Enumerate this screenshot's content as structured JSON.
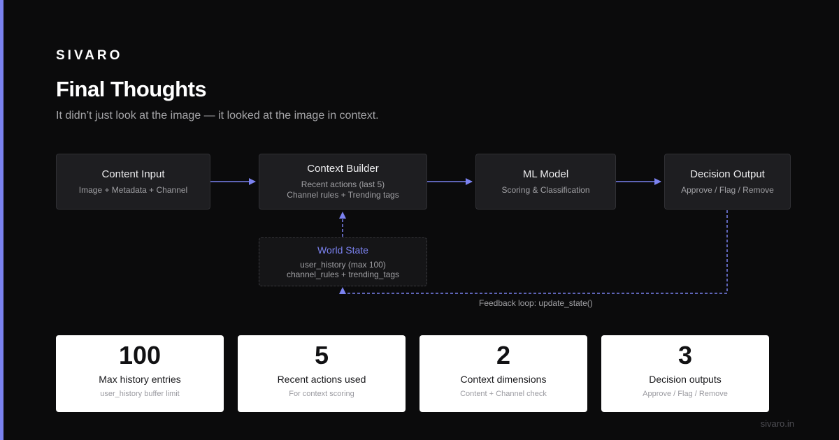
{
  "brand": "SIVARO",
  "title": "Final Thoughts",
  "subtitle": "It didn’t just look at the image — it looked at the image in context.",
  "colors": {
    "background": "#0b0b0c",
    "accent": "#7b82f0",
    "node": "#1e1e21",
    "card": "#ffffff"
  },
  "nodes": {
    "content_input": {
      "name": "Content Input",
      "desc": "Image + Metadata + Channel"
    },
    "context_builder": {
      "name": "Context Builder",
      "desc_1": "Recent actions (last 5)",
      "desc_2": "Channel rules + Trending tags"
    },
    "ml_model": {
      "name": "ML Model",
      "desc": "Scoring & Classification"
    },
    "decision_output": {
      "name": "Decision Output",
      "desc": "Approve / Flag / Remove"
    },
    "world_state": {
      "name": "World State",
      "desc_1": "user_history (max 100)",
      "desc_2": "channel_rules + trending_tags"
    }
  },
  "edges": [
    {
      "from": "content_input",
      "to": "context_builder",
      "style": "solid"
    },
    {
      "from": "context_builder",
      "to": "ml_model",
      "style": "solid"
    },
    {
      "from": "ml_model",
      "to": "decision_output",
      "style": "solid"
    },
    {
      "from": "world_state",
      "to": "context_builder",
      "style": "dashed"
    },
    {
      "from": "decision_output",
      "to": "world_state",
      "style": "dashed"
    }
  ],
  "feedback_label": "Feedback loop: update_state()",
  "stats": [
    {
      "value": "100",
      "label": "Max history entries",
      "sub": "user_history buffer limit"
    },
    {
      "value": "5",
      "label": "Recent actions used",
      "sub": "For context scoring"
    },
    {
      "value": "2",
      "label": "Context dimensions",
      "sub": "Content + Channel check"
    },
    {
      "value": "3",
      "label": "Decision outputs",
      "sub": "Approve / Flag / Remove"
    }
  ],
  "footer": "sivaro.in"
}
